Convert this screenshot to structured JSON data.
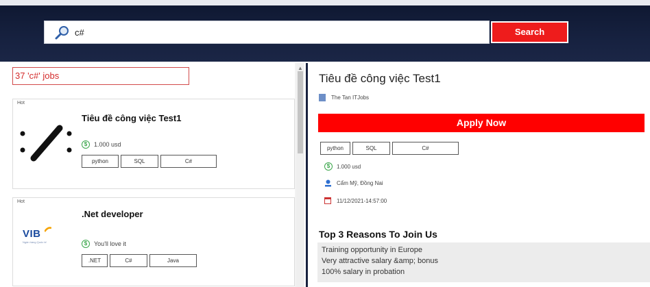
{
  "search": {
    "value": "c#",
    "button_label": "Search"
  },
  "results": {
    "count_label": "37 'c#' jobs",
    "jobs": [
      {
        "hot": "Hot",
        "title": "Tiêu đề công việc Test1",
        "salary": "1.000 usd",
        "tags": [
          "python",
          "SQL",
          "C#"
        ]
      },
      {
        "hot": "Hot",
        "title": ".Net developer",
        "salary": "You'll love it",
        "tags": [
          ".NET",
          "C#",
          "Java"
        ],
        "logo_text": "VIB",
        "logo_sub": "Ngân hàng Quốc tế"
      }
    ]
  },
  "detail": {
    "title": "Tiêu đề công việc Test1",
    "company": "The Tan ITJobs",
    "apply_label": "Apply Now",
    "tags": [
      "python",
      "SQL",
      "C#"
    ],
    "salary": "1.000 usd",
    "location": "Cẩm Mỹ, Đồng Nai",
    "date": "11/12/2021-14:57:00",
    "reasons_title": "Top 3 Reasons To Join Us",
    "reasons": [
      "Training opportunity in Europe",
      "Very attractive salary &amp; bonus",
      "100% salary in probation"
    ]
  },
  "colors": {
    "header_bg": "#16213f",
    "accent_red": "#ee1c1c",
    "salary_green": "#3aa64a"
  }
}
